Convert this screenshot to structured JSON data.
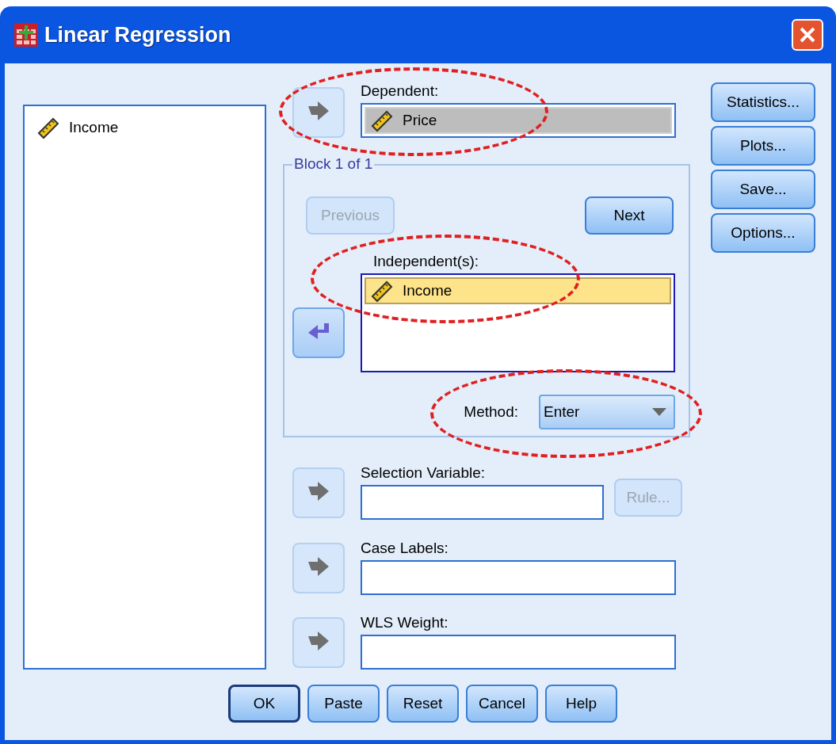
{
  "window": {
    "title": "Linear Regression"
  },
  "source_list": {
    "items": [
      {
        "label": "Income",
        "selected": false
      }
    ]
  },
  "dependent": {
    "label": "Dependent:",
    "highlighted": true,
    "arrow_enabled": false,
    "items": [
      {
        "label": "Price",
        "selected": true
      }
    ]
  },
  "block": {
    "title": "Block 1 of 1",
    "previous": {
      "label": "Previous",
      "disabled": true
    },
    "next": {
      "label": "Next",
      "disabled": false
    },
    "independents": {
      "label": "Independent(s):",
      "highlighted": true,
      "arrow_enabled": true,
      "items": [
        {
          "label": "Income",
          "selected": true
        }
      ]
    },
    "method": {
      "label": "Method:",
      "value": "Enter",
      "highlighted": true
    }
  },
  "selection_variable": {
    "label": "Selection Variable:",
    "arrow_enabled": false,
    "rule": {
      "label": "Rule...",
      "disabled": true
    }
  },
  "case_labels": {
    "label": "Case Labels:",
    "arrow_enabled": false
  },
  "wls_weight": {
    "label": "WLS Weight:",
    "arrow_enabled": false
  },
  "side_buttons": [
    {
      "label": "Statistics..."
    },
    {
      "label": "Plots..."
    },
    {
      "label": "Save..."
    },
    {
      "label": "Options..."
    }
  ],
  "bottom_buttons": [
    {
      "label": "OK",
      "default": true
    },
    {
      "label": "Paste",
      "default": false
    },
    {
      "label": "Reset",
      "default": false
    },
    {
      "label": "Cancel",
      "default": false
    },
    {
      "label": "Help",
      "default": false
    }
  ]
}
